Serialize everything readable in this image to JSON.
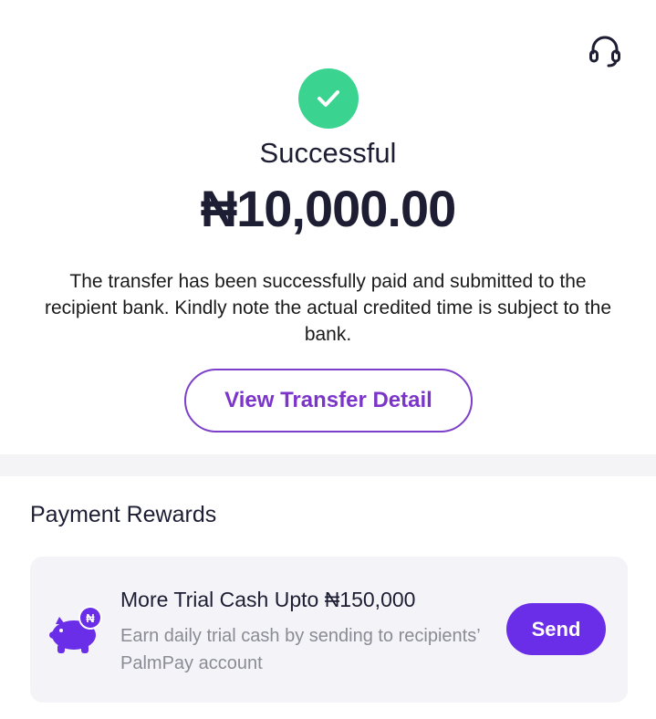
{
  "header": {
    "support_icon": "headset-icon"
  },
  "result": {
    "status_icon": "check-circle-icon",
    "status": "Successful",
    "amount": "₦10,000.00",
    "message": "The transfer has been successfully paid and submitted to the recipient bank. Kindly note the actual credited time is subject to the bank.",
    "detail_button": "View Transfer Detail"
  },
  "rewards": {
    "section_title": "Payment Rewards",
    "card": {
      "icon": "piggy-bank-icon",
      "coin_symbol": "₦",
      "title": "More Trial Cash Upto ₦150,000",
      "description": "Earn daily trial cash by sending to recipients’ PalmPay account",
      "button": "Send"
    }
  },
  "colors": {
    "success_green": "#3ad38f",
    "brand_purple": "#6a2ee8",
    "outline_purple": "#7c3fc9"
  }
}
